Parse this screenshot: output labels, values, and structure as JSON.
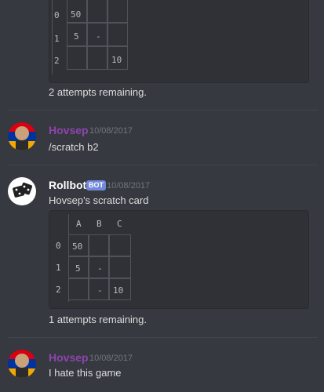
{
  "messages": {
    "m1": {
      "grid": {
        "rows": [
          {
            "label": "0",
            "cells": [
              "50",
              "",
              ""
            ]
          },
          {
            "label": "1",
            "cells": [
              "5",
              "-",
              ""
            ]
          },
          {
            "label": "2",
            "cells": [
              "",
              "",
              "10"
            ]
          }
        ]
      },
      "footer": "2 attempts remaining."
    },
    "m2": {
      "author": "Hovsep",
      "timestamp": "10/08/2017",
      "text": "/scratch b2",
      "author_color": "#8e44ad"
    },
    "m3": {
      "author": "Rollbot",
      "badge": "BOT",
      "timestamp": "10/08/2017",
      "text": "Hovsep's scratch card",
      "grid": {
        "headers": [
          "A",
          "B",
          "C"
        ],
        "rows": [
          {
            "label": "0",
            "cells": [
              "50",
              "",
              ""
            ]
          },
          {
            "label": "1",
            "cells": [
              "5",
              "-",
              ""
            ]
          },
          {
            "label": "2",
            "cells": [
              "",
              "-",
              "10"
            ]
          }
        ]
      },
      "footer": "1 attempts remaining."
    },
    "m4": {
      "author": "Hovsep",
      "timestamp": "10/08/2017",
      "text": "I hate this game",
      "author_color": "#8e44ad"
    }
  },
  "colors": {
    "background": "#36393f",
    "code_block": "#2f3136",
    "bot_badge": "#7289da",
    "timestamp": "#72767d"
  }
}
